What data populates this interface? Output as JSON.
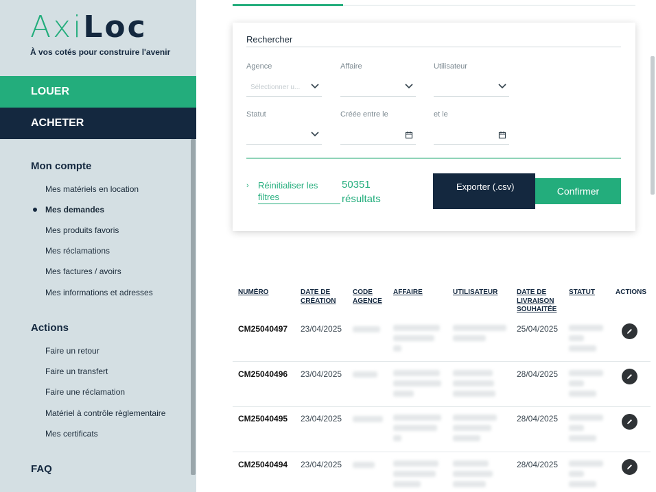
{
  "brand": {
    "part1": "Axi",
    "part2": "Loc",
    "tagline": "À vos cotés pour construire l'avenir"
  },
  "nav": {
    "louer": "LOUER",
    "acheter": "ACHETER"
  },
  "account": {
    "title": "Mon compte",
    "items": [
      "Mes matériels en location",
      "Mes demandes",
      "Mes produits favoris",
      "Mes réclamations",
      "Mes factures / avoirs",
      "Mes informations et adresses"
    ]
  },
  "actions": {
    "title": "Actions",
    "items": [
      "Faire un retour",
      "Faire un transfert",
      "Faire une réclamation",
      "Matériel à contrôle règlementaire",
      "Mes certificats"
    ]
  },
  "faq": "FAQ",
  "search": {
    "title": "Rechercher",
    "agence_label": "Agence",
    "agence_placeholder": "Sélectionner u...",
    "affaire_label": "Affaire",
    "utilisateur_label": "Utilisateur",
    "statut_label": "Statut",
    "creee_label": "Créée entre le",
    "et_le_label": "et le",
    "reset_label": "Réinitialiser les filtres",
    "results_count": "50351",
    "results_label": "résultats",
    "export_label": "Exporter (.csv)",
    "confirm_label": "Confirmer"
  },
  "table": {
    "headers": {
      "numero": "NUMÉRO",
      "date_creation": "DATE DE CRÉATION",
      "code_agence": "CODE AGENCE",
      "affaire": "AFFAIRE",
      "utilisateur": "UTILISATEUR",
      "date_livraison": "DATE DE LIVRAISON SOUHAITÉE",
      "statut": "STATUT",
      "actions": "ACTIONS"
    },
    "rows": [
      {
        "numero": "CM25040497",
        "date_creation": "23/04/2025",
        "date_livraison": "25/04/2025"
      },
      {
        "numero": "CM25040496",
        "date_creation": "23/04/2025",
        "date_livraison": "28/04/2025"
      },
      {
        "numero": "CM25040495",
        "date_creation": "23/04/2025",
        "date_livraison": "28/04/2025"
      },
      {
        "numero": "CM25040494",
        "date_creation": "23/04/2025",
        "date_livraison": "28/04/2025"
      }
    ]
  },
  "colors": {
    "green": "#23ad7c",
    "navy": "#14283f",
    "sidebar": "#d4dfe3"
  }
}
